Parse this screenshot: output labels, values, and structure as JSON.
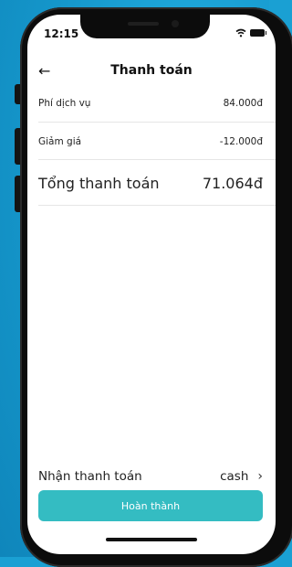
{
  "status": {
    "time": "12:15"
  },
  "header": {
    "title": "Thanh toán"
  },
  "fees": [
    {
      "label": "Phí dịch vụ",
      "value": "84.000đ"
    },
    {
      "label": "Giảm giá",
      "value": "-12.000đ"
    }
  ],
  "total": {
    "label": "Tổng thanh toán",
    "value": "71.064đ"
  },
  "payment": {
    "label": "Nhận thanh toán",
    "method": "cash"
  },
  "actions": {
    "complete_label": "Hoàn thành"
  },
  "colors": {
    "background": "#1aa0d3",
    "accent": "#34bcc2"
  }
}
